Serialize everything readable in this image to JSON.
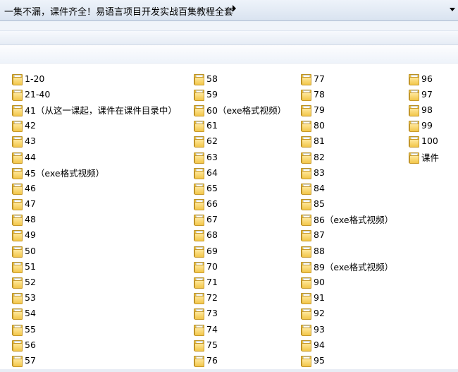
{
  "address": {
    "path": "一集不漏，课件齐全！易语言项目开发实战百集教程全套"
  },
  "folders": [
    [
      "1-20",
      "21-40",
      "41（从这一课起，课件在课件目录中）",
      "42",
      "43",
      "44",
      "45（exe格式视频）",
      "46",
      "47",
      "48",
      "49",
      "50",
      "51",
      "52",
      "53",
      "54",
      "55",
      "56",
      "57"
    ],
    [
      "58",
      "59",
      "60（exe格式视频）",
      "61",
      "62",
      "63",
      "64",
      "65",
      "66",
      "67",
      "68",
      "69",
      "70",
      "71",
      "72",
      "73",
      "74",
      "75",
      "76"
    ],
    [
      "77",
      "78",
      "79",
      "80",
      "81",
      "82",
      "83",
      "84",
      "85",
      "86（exe格式视频）",
      "87",
      "88",
      "89（exe格式视频）",
      "90",
      "91",
      "92",
      "93",
      "94",
      "95"
    ],
    [
      "96",
      "97",
      "98",
      "99",
      "100",
      "课件"
    ]
  ]
}
